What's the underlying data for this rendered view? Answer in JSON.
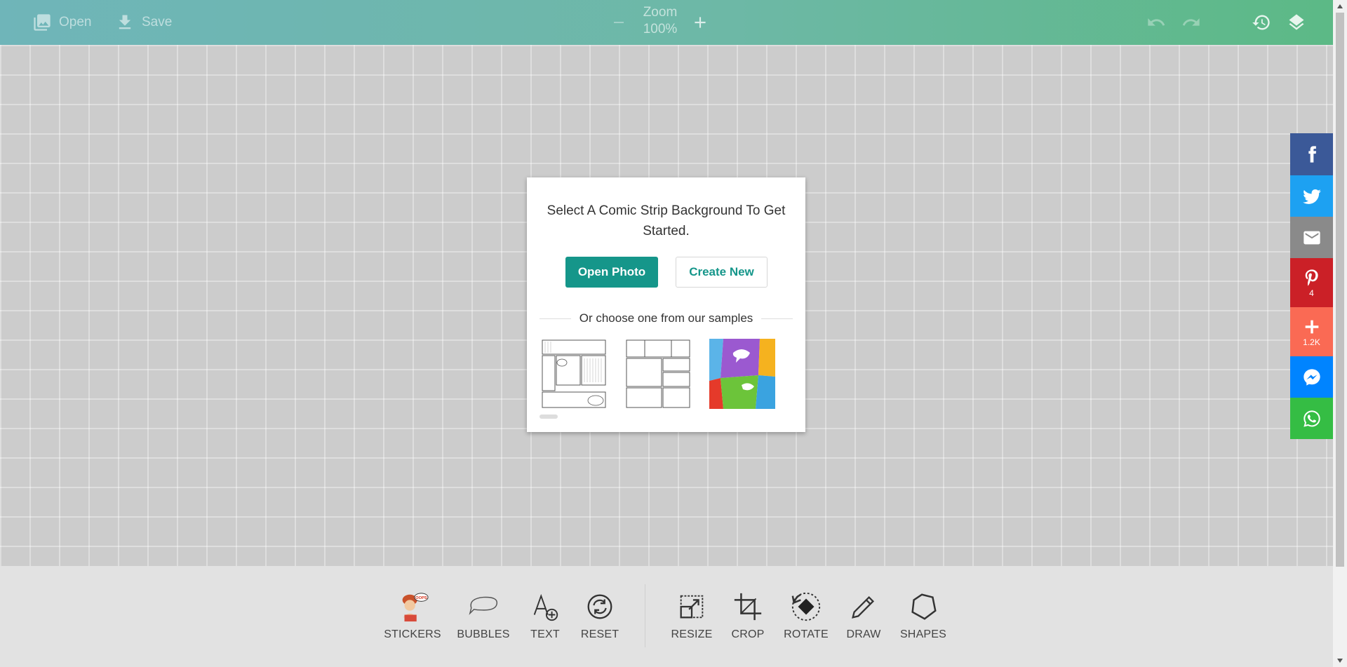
{
  "toolbar": {
    "open_label": "Open",
    "save_label": "Save",
    "zoom_label": "Zoom",
    "zoom_value": "100%",
    "icons": {
      "open": "image-icon",
      "save": "download-icon",
      "zoom_out": "minus-icon",
      "zoom_in": "plus-icon",
      "undo": "undo-icon",
      "redo": "redo-icon",
      "history": "history-icon",
      "layers": "layers-icon"
    }
  },
  "dialog": {
    "title": "Select A Comic Strip Background To Get Started.",
    "open_photo_label": "Open Photo",
    "create_new_label": "Create New",
    "samples_label": "Or choose one from our samples",
    "primary_color": "#15968a"
  },
  "social": [
    {
      "network": "facebook",
      "icon": "facebook-icon",
      "color": "#3b5998",
      "count": ""
    },
    {
      "network": "twitter",
      "icon": "twitter-icon",
      "color": "#1da1f2",
      "count": ""
    },
    {
      "network": "email",
      "icon": "email-icon",
      "color": "#8a8a8a",
      "count": ""
    },
    {
      "network": "pinterest",
      "icon": "pinterest-icon",
      "color": "#cb2027",
      "count": "4"
    },
    {
      "network": "share",
      "icon": "plus-icon",
      "color": "#fa6a54",
      "count": "1.2K"
    },
    {
      "network": "messenger",
      "icon": "messenger-icon",
      "color": "#0084ff",
      "count": ""
    },
    {
      "network": "whatsapp",
      "icon": "whatsapp-icon",
      "color": "#35bd44",
      "count": ""
    }
  ],
  "tools": {
    "stickers": "STICKERS",
    "bubbles": "BUBBLES",
    "text": "TEXT",
    "reset": "RESET",
    "resize": "RESIZE",
    "crop": "CROP",
    "rotate": "ROTATE",
    "draw": "DRAW",
    "shapes": "SHAPES"
  }
}
